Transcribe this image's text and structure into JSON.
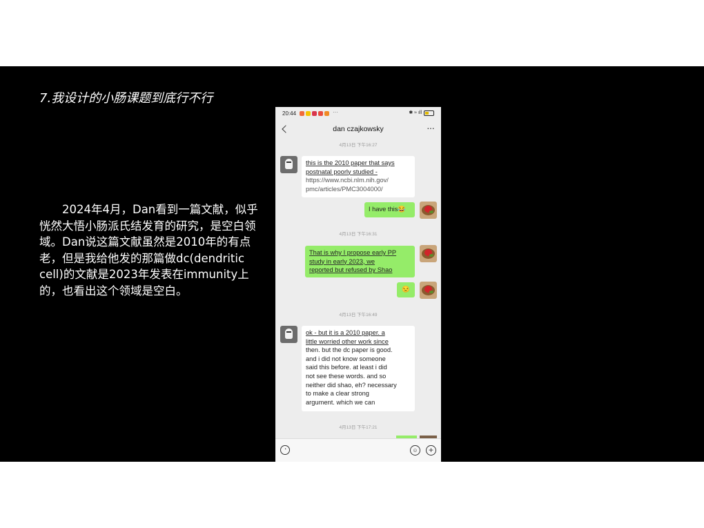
{
  "slide": {
    "title": "7.我设计的小肠课题到底行不行",
    "body": "2024年4月，Dan看到一篇文献，似乎恍然大悟小肠派氏结发育的研究，是空白领域。Dan说这篇文献虽然是2010年的有点老，但是我给他发的那篇做dc(dendritic cell)的文献是2023年发表在immunity上的，也看出这个领域是空白。"
  },
  "phone": {
    "status_bar": {
      "time": "20:44",
      "more": "···",
      "icons": "✱ ≈ ıll"
    },
    "header": {
      "contact_name": "dan czajkowsky",
      "more": "···"
    },
    "messages": {
      "ts1": "4月13日 下午16:27",
      "m1": {
        "l1": "this is the 2010 paper that says",
        "l2": "postnatal poorly studied -",
        "l3": "https://www.ncbi.nlm.nih.gov/",
        "l4": "pmc/articles/PMC3004000/"
      },
      "m2": {
        "text": "I have this",
        "emoji": "😂"
      },
      "ts2": "4月13日 下午16:31",
      "m3": {
        "l1": "That is why I propose early PP",
        "l2": "study in early 2023, we",
        "l3": "reported but refused by Shao"
      },
      "m4": {
        "emoji": "😒"
      },
      "ts3": "4月13日 下午16:49",
      "m5": {
        "l1": "ok - but it is a 2010 paper. a",
        "l2": "little worried other work since",
        "l3": "then. but the dc paper is good.",
        "l4": "and i did not know someone",
        "l5": "said this before. at least i did",
        "l6": "not see these words. and so",
        "l7": "neither did shao, eh? necessary",
        "l8": "to make a clear strong",
        "l9": "argument. which we can"
      },
      "ts4": "4月13日 下午17:21"
    },
    "input_bar": {
      "voice_icon": "◔",
      "emoji_icon": "☺",
      "plus_icon": "+"
    }
  }
}
